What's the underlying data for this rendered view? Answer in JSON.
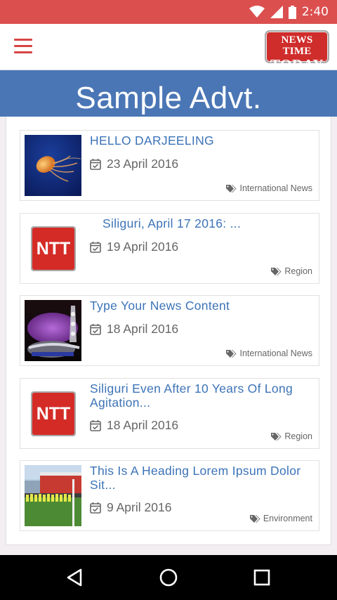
{
  "status_bar": {
    "time": "2:40",
    "icons": [
      "wifi-icon",
      "cell-signal-icon",
      "battery-icon"
    ]
  },
  "app_bar": {
    "menu_icon": "hamburger-menu-icon",
    "logo": {
      "line1": "NEWS TIME",
      "line2": "TODAY"
    }
  },
  "ad_banner": {
    "text": "Sample Advt."
  },
  "colors": {
    "status_bar": "#dc4f4f",
    "accent_red": "#d74545",
    "banner_blue": "#4a76b5",
    "title_blue": "#3c73b7"
  },
  "news": [
    {
      "title": "HELLO DARJEELING",
      "date": "23 April 2016",
      "category": "International News",
      "thumbnail": "jellyfish-photo"
    },
    {
      "title": "Siliguri, April 17 2016:     ...",
      "date": "19 April 2016",
      "category": "Region",
      "thumbnail": "ntt-logo",
      "thumb_label": "NTT"
    },
    {
      "title": "Type Your News Content",
      "date": "18 April 2016",
      "category": "International News",
      "thumbnail": "crown-photo"
    },
    {
      "title": "Siliguri Even After 10 Years Of Long Agitation...",
      "date": "18 April 2016",
      "category": "Region",
      "thumbnail": "ntt-logo",
      "thumb_label": "NTT"
    },
    {
      "title": "This Is A Heading Lorem Ipsum Dolor Sit...",
      "date": "9 April 2016",
      "category": "Environment",
      "thumbnail": "football-team-photo"
    }
  ],
  "nav_bar": {
    "buttons": [
      "back-icon",
      "home-icon",
      "recents-icon"
    ]
  }
}
